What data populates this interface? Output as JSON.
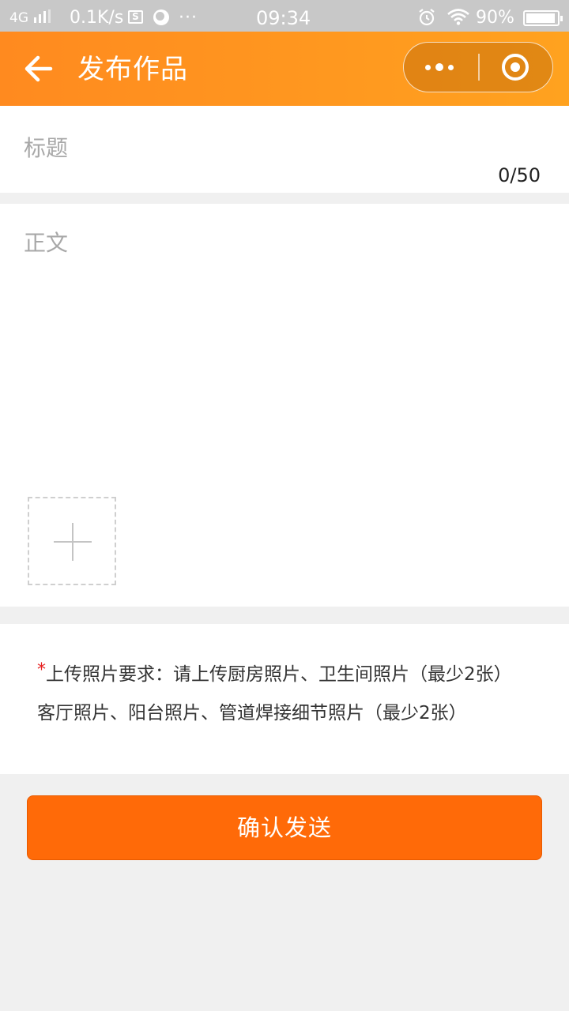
{
  "status_bar": {
    "signal": "4G",
    "net_speed": "0.1K/s",
    "s_icon_text": "S",
    "more": "···",
    "time": "09:34",
    "battery": "90%",
    "icons": [
      "signal-icon",
      "s-app-icon",
      "ball-app-icon",
      "alarm-icon",
      "wifi-icon",
      "battery-icon"
    ]
  },
  "header": {
    "title": "发布作品",
    "back_icon": "arrow-left-icon",
    "capsule_icons": [
      "more-dots-icon",
      "close-target-icon"
    ],
    "colors": {
      "gradient_start": "#ff8a1f",
      "gradient_end": "#ffa21f"
    }
  },
  "title_field": {
    "placeholder": "标题",
    "value": "",
    "counter": "0/50"
  },
  "body_field": {
    "placeholder": "正文",
    "value": "",
    "upload_icon": "plus-icon"
  },
  "requirements": {
    "star": "*",
    "line1": "上传照片要求：请上传厨房照片、卫生间照片（最少2张）",
    "line2": "客厅照片、阳台照片、管道焊接细节照片（最少2张）"
  },
  "submit": {
    "label": "确认发送",
    "color": "#ff6a08"
  }
}
